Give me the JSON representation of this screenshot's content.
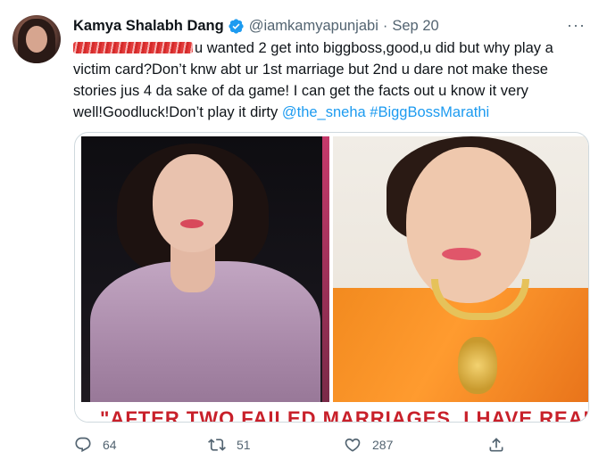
{
  "tweet": {
    "author_name": "Kamya Shalabh Dang",
    "handle": "@iamkamyapunjabi",
    "separator": "·",
    "date": "Sep 20",
    "more": "···",
    "text_part1": "u wanted 2 get into biggboss,good,u did but why play a victim card?Don’t knw abt ur 1st marriage but 2nd u dare not make these stories jus 4 da sake of da game! I can get the facts out u know it very well!Goodluck!Don’t play it dirty ",
    "mention": "@the_sneha",
    "hashtag": "#BiggBossMarathi",
    "media_caption": "\"AFTER TWO FAILED MARRIAGES, I HAVE REALISED",
    "icons": {
      "verified": "verified-badge-icon",
      "more": "more-icon",
      "reply": "reply-icon",
      "retweet": "retweet-icon",
      "like": "heart-icon",
      "share": "share-icon"
    },
    "colors": {
      "link": "#1d9bf0",
      "secondary": "#536471",
      "verified": "#1d9bf0",
      "caption": "#c8202a"
    }
  },
  "actions": {
    "reply_count": "64",
    "retweet_count": "51",
    "like_count": "287"
  }
}
